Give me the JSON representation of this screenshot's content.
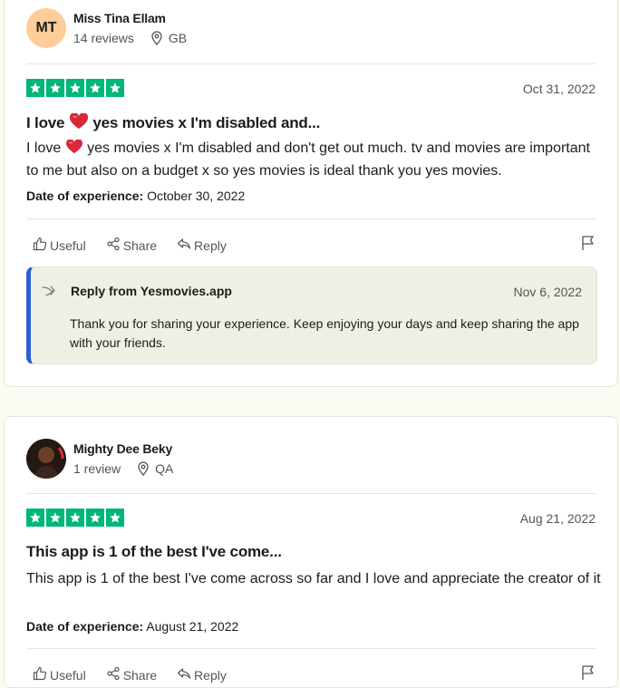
{
  "reviews": [
    {
      "avatar_initials": "MT",
      "avatar_color": "#ffcc99",
      "name": "Miss Tina Ellam",
      "review_count": "14 reviews",
      "country": "GB",
      "rating": 5,
      "date": "Oct 31, 2022",
      "title_pre": "I love",
      "title_post": "yes movies x I'm disabled and...",
      "body_pre": "I love",
      "body_post": "yes movies x I'm disabled and don't get out much. tv and movies are important to me but also on a budget x so yes movies is ideal thank you yes movies.",
      "experience_label": "Date of experience:",
      "experience_date": "October 30, 2022",
      "actions": {
        "useful": "Useful",
        "share": "Share",
        "reply": "Reply"
      },
      "reply": {
        "from": "Reply from Yesmovies.app",
        "date": "Nov 6, 2022",
        "text": "Thank you for sharing your experience. Keep enjoying your days and keep sharing the app with your friends."
      }
    },
    {
      "name": "Mighty Dee Beky",
      "review_count": "1 review",
      "country": "QA",
      "rating": 5,
      "date": "Aug 21, 2022",
      "title": "This app is 1 of the best I've come...",
      "body": "This app is 1 of the best I've come across so far and I love and appreciate the creator of it",
      "experience_label": "Date of experience:",
      "experience_date": "August 21, 2022",
      "actions": {
        "useful": "Useful",
        "share": "Share",
        "reply": "Reply"
      }
    }
  ],
  "colors": {
    "star_green": "#00b67a",
    "reply_accent": "#2a5fd6",
    "page_bg": "#fcfbf3"
  },
  "icons": [
    "location-pin-icon",
    "star-icon",
    "heart-icon",
    "thumbs-up-icon",
    "share-icon",
    "reply-icon",
    "flag-icon",
    "reply-arrow-icon"
  ]
}
